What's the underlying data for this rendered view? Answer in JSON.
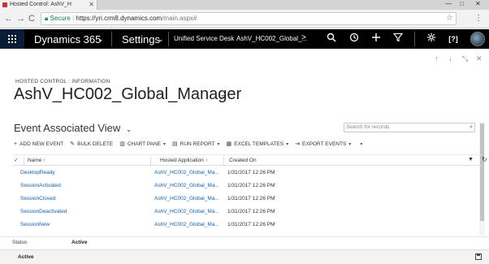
{
  "browser": {
    "tab_title": "Hosted Control: AshV_H",
    "secure_label": "Secure",
    "url_host": "https://yri.crm8.dynamics.com",
    "url_path": "/main.aspx#",
    "back": "←",
    "forward": "→",
    "reload": "C",
    "star": "☆",
    "menu": "⋮",
    "win_min": "—",
    "win_max": "□",
    "win_close": "✕"
  },
  "nav": {
    "product": "Dynamics 365",
    "area": "Settings",
    "entity": "Unified Service Desk",
    "record": "AshV_HC002_Global_...",
    "more": ">",
    "chevron": "⌄"
  },
  "page": {
    "label": "HOSTED CONTROL : INFORMATION",
    "title": "AshV_HC002_Global_Manager",
    "view_title": "Event Associated View",
    "view_chevron": "⌄",
    "search_placeholder": "Search for records"
  },
  "commands": [
    {
      "icon": "+",
      "label": "ADD NEW EVENT",
      "caret": ""
    },
    {
      "icon": "✎",
      "label": "BULK DELETE",
      "caret": ""
    },
    {
      "icon": "▥",
      "label": "CHART PANE",
      "caret": "▾"
    },
    {
      "icon": "▤",
      "label": "RUN REPORT",
      "caret": "▾"
    },
    {
      "icon": "▦",
      "label": "EXCEL TEMPLATES",
      "caret": "▾"
    },
    {
      "icon": "⇥",
      "label": "EXPORT EVENTS",
      "caret": "▾"
    },
    {
      "icon": "",
      "label": "",
      "caret": "▾"
    }
  ],
  "grid": {
    "columns": [
      "Name ↑",
      "Hosted Application ↑",
      "Created On"
    ],
    "rows": [
      {
        "name": "DesktopReady",
        "app": "AshV_HC002_Global_Ma...",
        "created": "1/31/2017 12:26 PM"
      },
      {
        "name": "SessionActivated",
        "app": "AshV_HC002_Global_Ma...",
        "created": "1/31/2017 12:26 PM"
      },
      {
        "name": "SessionClosed",
        "app": "AshV_HC002_Global_Ma...",
        "created": "1/31/2017 12:26 PM"
      },
      {
        "name": "SessionDeactivated",
        "app": "AshV_HC002_Global_Ma...",
        "created": "1/31/2017 12:26 PM"
      },
      {
        "name": "SessionNew",
        "app": "AshV_HC002_Global_Ma...",
        "created": "1/31/2017 12:26 PM"
      }
    ]
  },
  "status": {
    "label": "Status",
    "value": "Active",
    "footer": "Active"
  },
  "colors": {
    "nav_bg": "#000000",
    "waffle_bg": "#0a1d37",
    "link": "#1160b7"
  }
}
